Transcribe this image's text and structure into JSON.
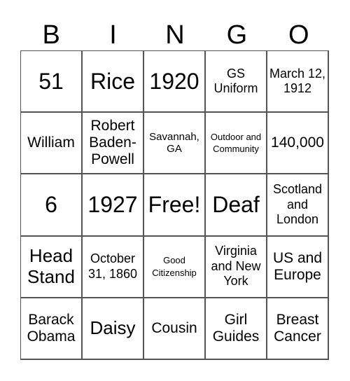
{
  "header": {
    "letters": [
      "B",
      "I",
      "N",
      "G",
      "O"
    ]
  },
  "grid": {
    "rows": [
      [
        "51",
        "Rice",
        "1920",
        "GS Uniform",
        "March 12, 1912"
      ],
      [
        "William",
        "Robert Baden-Powell",
        "Savannah, GA",
        "Outdoor and Community",
        "140,000"
      ],
      [
        "6",
        "1927",
        "Free!",
        "Deaf",
        "Scotland and London"
      ],
      [
        "Head Stand",
        "October 31, 1860",
        "Good Citizenship",
        "Virginia and New York",
        "US and Europe"
      ],
      [
        "Barack Obama",
        "Daisy",
        "Cousin",
        "Girl Guides",
        "Breast Cancer"
      ]
    ]
  }
}
